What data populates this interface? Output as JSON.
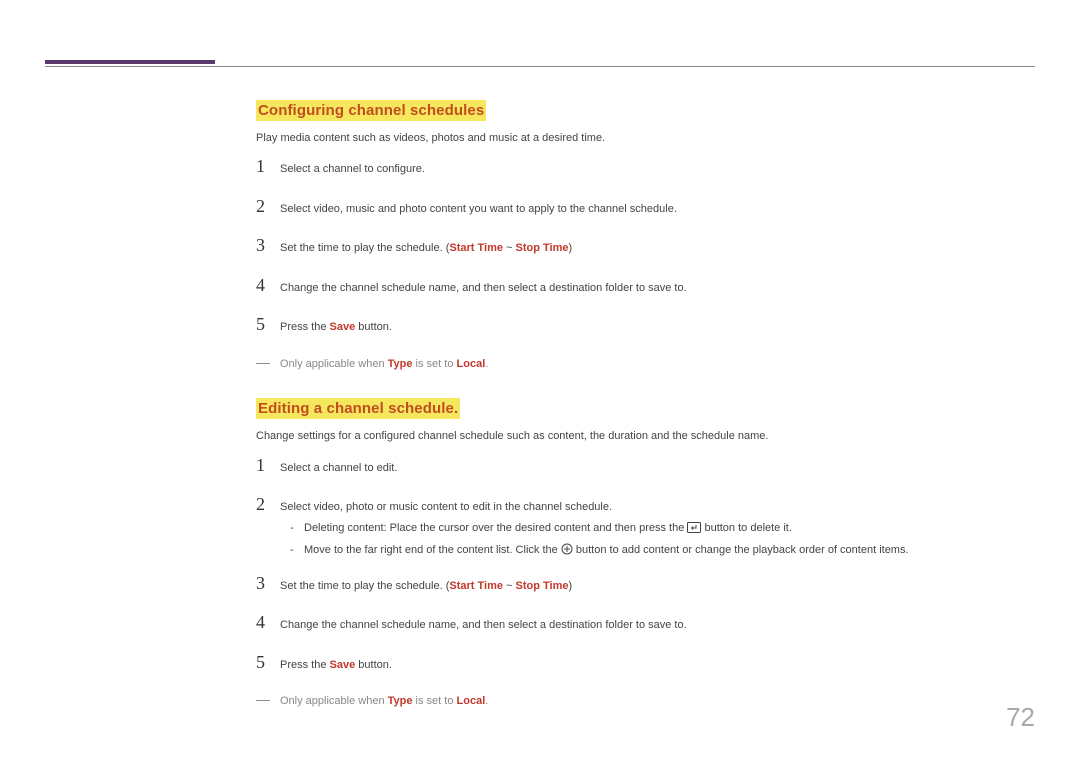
{
  "pageNumber": "72",
  "section1": {
    "heading": "Configuring channel schedules",
    "intro": "Play media content such as videos, photos and music at a desired time.",
    "step1": "Select a channel to configure.",
    "step2": "Select video, music and photo content you want to apply to the channel schedule.",
    "step3_a": "Set the time to play the schedule. (",
    "step3_b": "Start Time",
    "step3_c": " ~ ",
    "step3_d": "Stop Time",
    "step3_e": ")",
    "step4": "Change the channel schedule name, and then select a destination folder to save to.",
    "step5_a": "Press the ",
    "step5_b": "Save",
    "step5_c": " button.",
    "note_a": "Only applicable when ",
    "note_b": "Type",
    "note_c": " is set to ",
    "note_d": "Local",
    "note_e": "."
  },
  "section2": {
    "heading": "Editing a channel schedule.",
    "intro": "Change settings for a configured channel schedule such as content, the duration and the schedule name.",
    "step1": "Select a channel to edit.",
    "step2": "Select video, photo or music content to edit in the channel schedule.",
    "sub1_a": "Deleting content: Place the cursor over the desired content and then press the ",
    "sub1_b": " button to delete it.",
    "sub2_a": "Move to the far right end of the content list. Click the ",
    "sub2_b": " button to add content or change the playback order of content items.",
    "step3_a": "Set the time to play the schedule. (",
    "step3_b": "Start Time",
    "step3_c": " ~ ",
    "step3_d": "Stop Time",
    "step3_e": ")",
    "step4": "Change the channel schedule name, and then select a destination folder to save to.",
    "step5_a": "Press the ",
    "step5_b": "Save",
    "step5_c": " button.",
    "note_a": "Only applicable when ",
    "note_b": "Type",
    "note_c": " is set to ",
    "note_d": "Local",
    "note_e": "."
  },
  "numbers": {
    "n1": "1",
    "n2": "2",
    "n3": "3",
    "n4": "4",
    "n5": "5"
  },
  "dashes": {
    "long": "―",
    "short": "-"
  }
}
